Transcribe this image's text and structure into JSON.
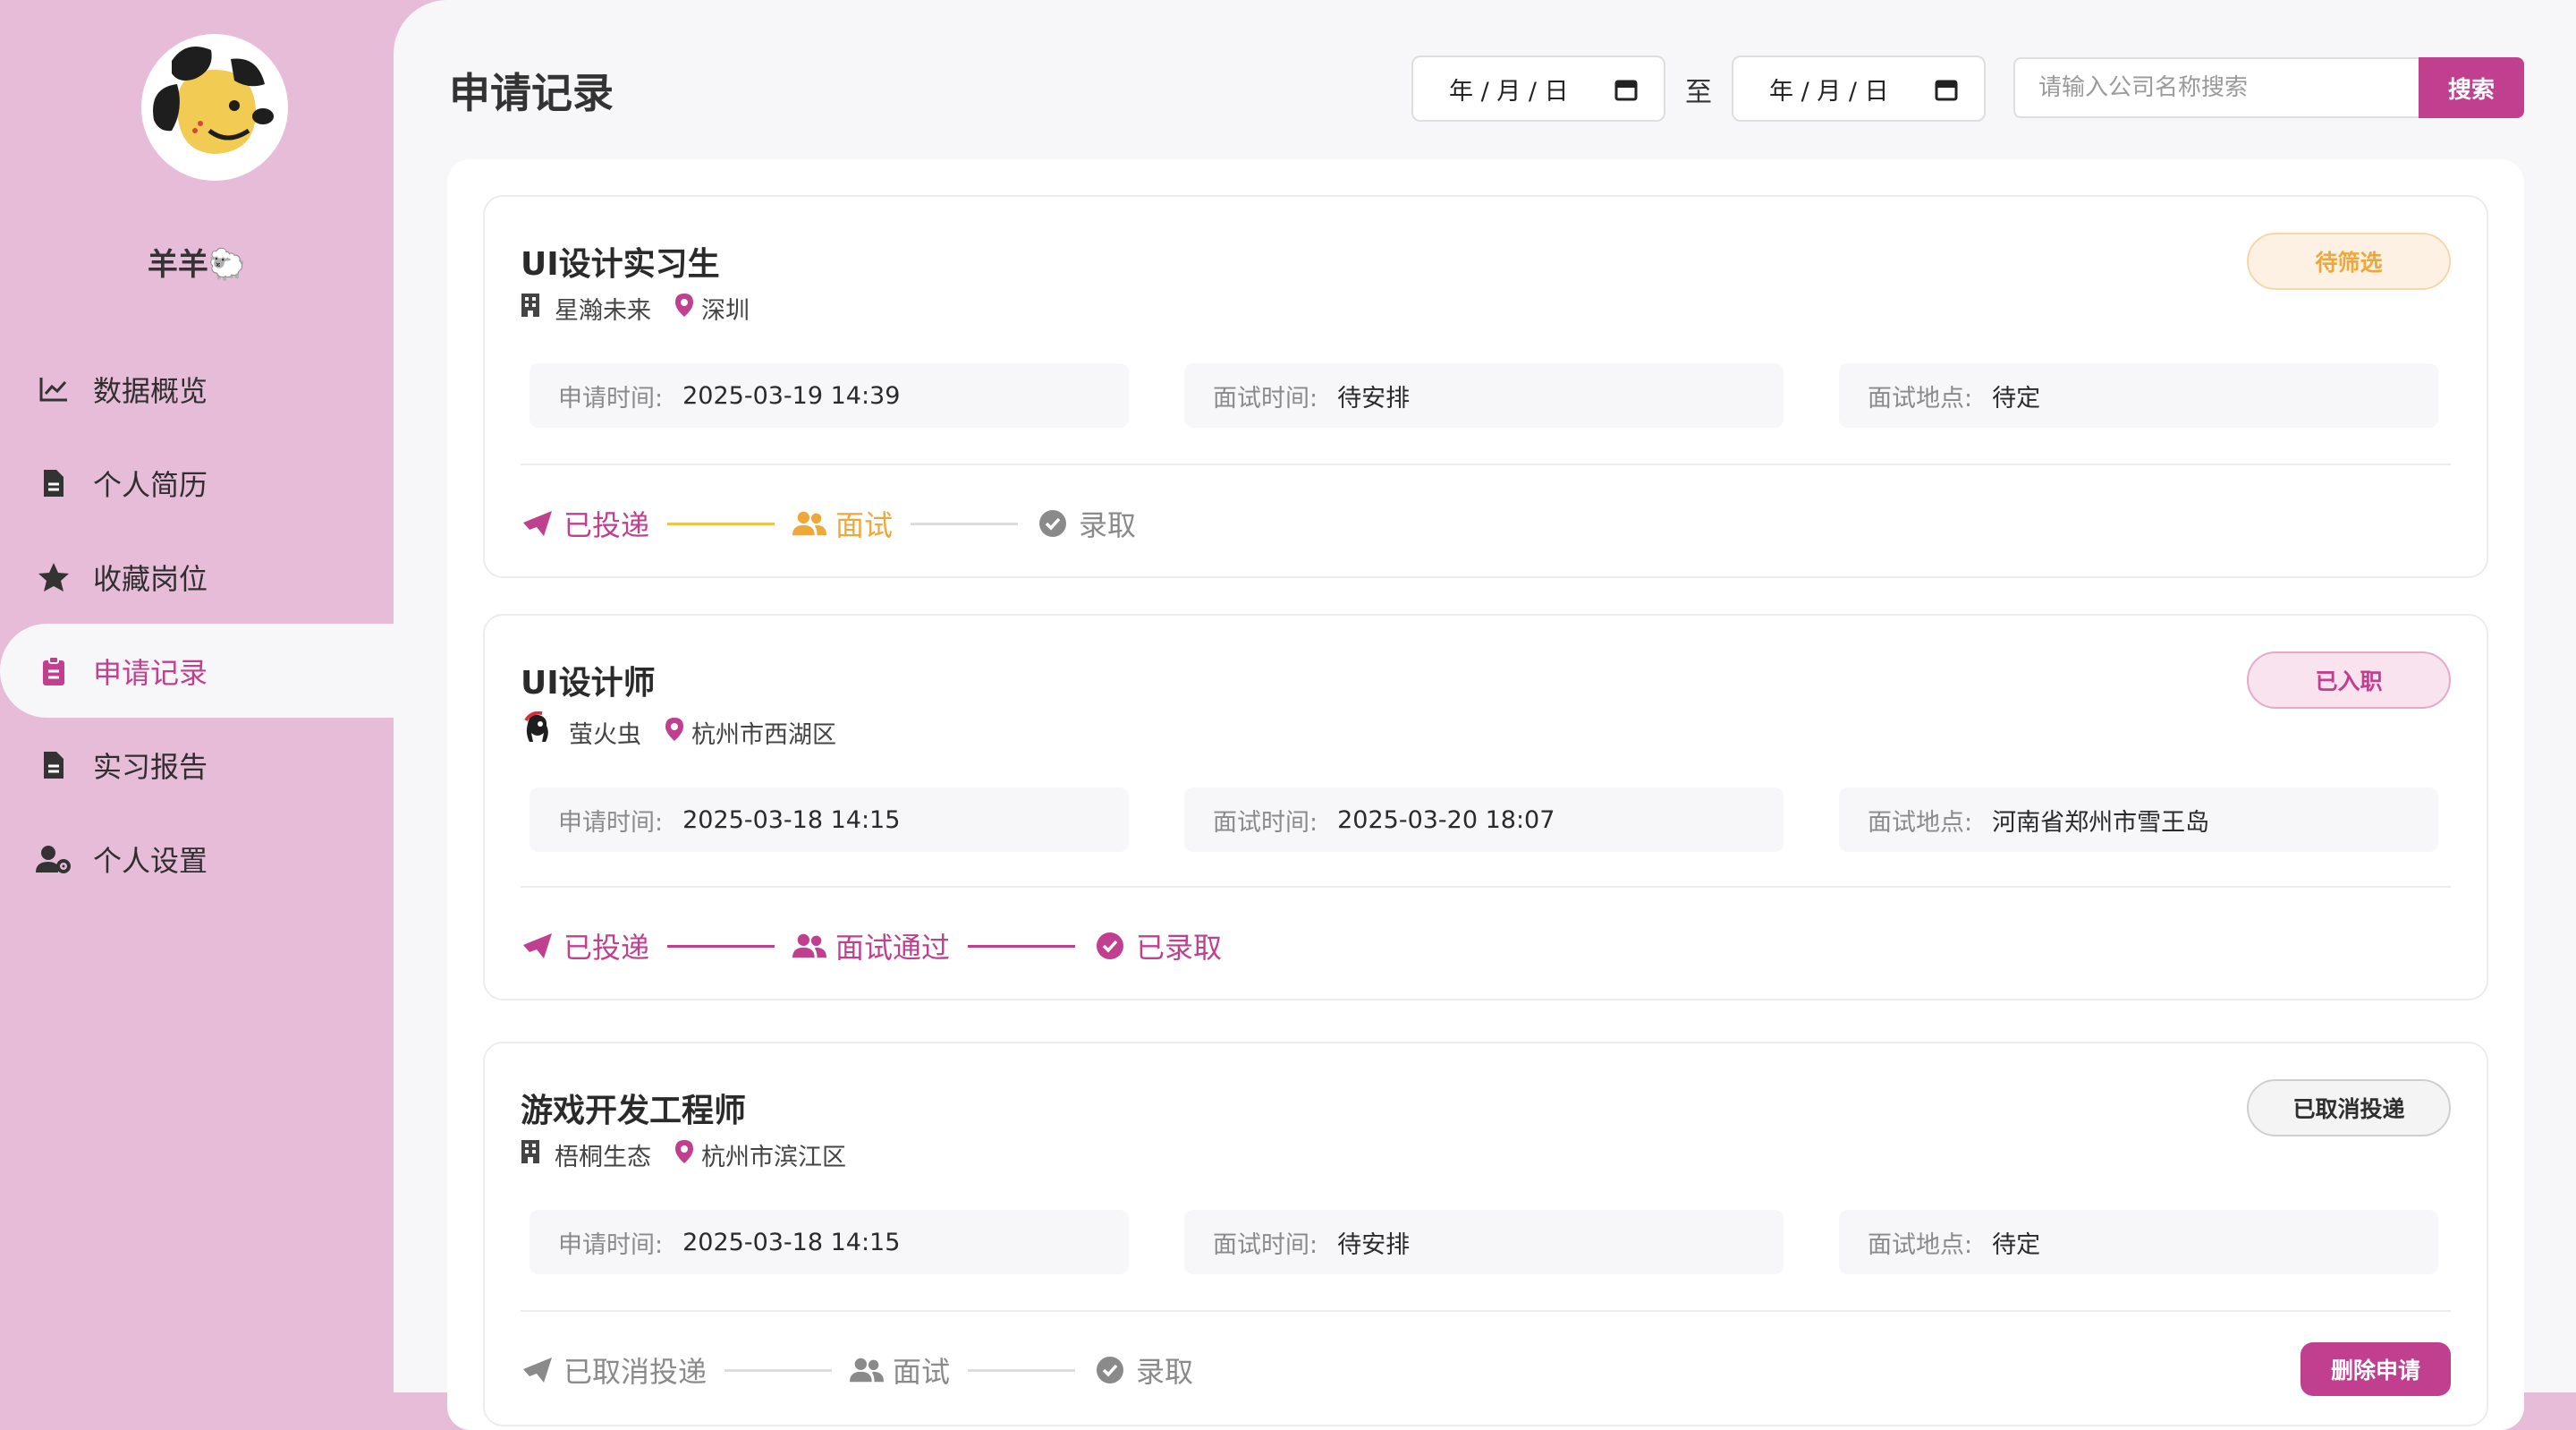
{
  "sidebar": {
    "username": "羊羊🐑",
    "items": [
      {
        "label": "数据概览",
        "icon": "chart-line-icon"
      },
      {
        "label": "个人简历",
        "icon": "file-icon"
      },
      {
        "label": "收藏岗位",
        "icon": "star-icon"
      },
      {
        "label": "申请记录",
        "icon": "clipboard-icon",
        "active": true
      },
      {
        "label": "实习报告",
        "icon": "file-icon"
      },
      {
        "label": "个人设置",
        "icon": "user-gear-icon"
      }
    ]
  },
  "header": {
    "title": "申请记录",
    "date_from_placeholder": "年 / 月 / 日",
    "to_label": "至",
    "date_to_placeholder": "年 / 月 / 日",
    "search_placeholder": "请输入公司名称搜索",
    "search_label": "搜索"
  },
  "applications": [
    {
      "title": "UI设计实习生",
      "company": "星瀚未来",
      "city": "深圳",
      "status": "待筛选",
      "apply_time_label": "申请时间:",
      "apply_time": "2025-03-19 14:39",
      "interview_time_label": "面试时间:",
      "interview_time": "待安排",
      "interview_place_label": "面试地点:",
      "interview_place": "待定",
      "steps": [
        "已投递",
        "面试",
        "录取"
      ]
    },
    {
      "title": "UI设计师",
      "company": "萤火虫",
      "city": "杭州市西湖区",
      "status": "已入职",
      "apply_time_label": "申请时间:",
      "apply_time": "2025-03-18 14:15",
      "interview_time_label": "面试时间:",
      "interview_time": "2025-03-20 18:07",
      "interview_place_label": "面试地点:",
      "interview_place": "河南省郑州市雪王岛",
      "steps": [
        "已投递",
        "面试通过",
        "已录取"
      ]
    },
    {
      "title": "游戏开发工程师",
      "company": "梧桐生态",
      "city": "杭州市滨江区",
      "status": "已取消投递",
      "apply_time_label": "申请时间:",
      "apply_time": "2025-03-18 14:15",
      "interview_time_label": "面试时间:",
      "interview_time": "待安排",
      "interview_place_label": "面试地点:",
      "interview_place": "待定",
      "steps": [
        "已取消投递",
        "面试",
        "录取"
      ],
      "delete_label": "删除申请"
    }
  ],
  "colors": {
    "accent": "#c0408f",
    "pending": "#f0a73a",
    "muted": "#8a8a8a",
    "sidebar_bg": "#e6bcd8"
  }
}
